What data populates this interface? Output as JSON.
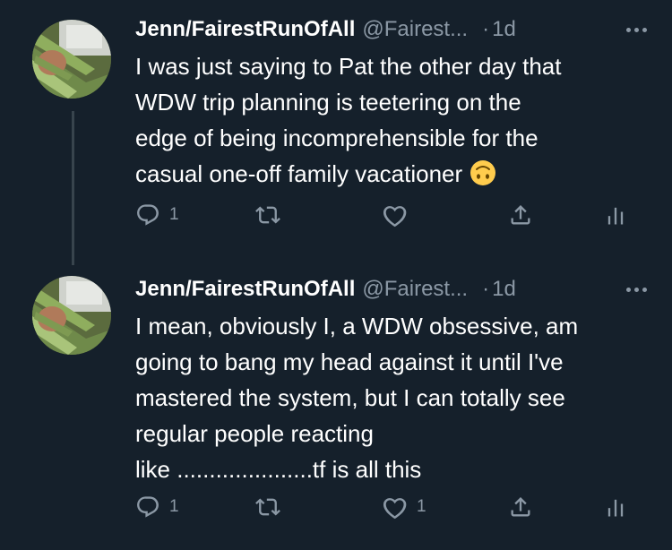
{
  "tweets": [
    {
      "display_name": "Jenn/FairestRunOfAll",
      "handle": "@Fairest...",
      "separator": "·",
      "time": "1d",
      "lines": [
        "I was just saying to Pat the other day that",
        "WDW trip planning is teetering on the",
        "edge of being incomprehensible for the",
        "casual one-off family vacationer"
      ],
      "emoji": "upside-down-face-emoji",
      "reply_count": "1",
      "retweet_count": "",
      "like_count": ""
    },
    {
      "display_name": "Jenn/FairestRunOfAll",
      "handle": "@Fairest...",
      "separator": "·",
      "time": "1d",
      "lines": [
        "I mean, obviously I, a WDW obsessive, am",
        "going to bang my head against it until I've",
        "mastered the system, but I can totally see",
        "regular people reacting",
        "like .....................tf is all this"
      ],
      "reply_count": "1",
      "retweet_count": "",
      "like_count": "1"
    }
  ],
  "colors": {
    "background": "#15202b",
    "text": "#ffffff",
    "secondary": "#8b98a5",
    "thread_line": "#38444d"
  },
  "icons": [
    "reply-icon",
    "retweet-icon",
    "like-icon",
    "share-icon",
    "analytics-icon",
    "more-icon"
  ]
}
